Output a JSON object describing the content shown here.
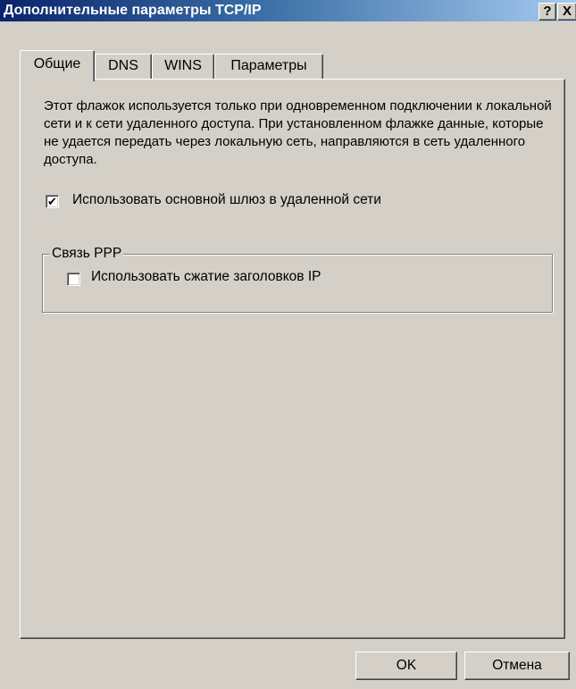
{
  "window": {
    "title": "Дополнительные параметры TCP/IP",
    "help_glyph": "?",
    "close_glyph": "X"
  },
  "tabs": [
    {
      "label": "Общие",
      "active": true
    },
    {
      "label": "DNS",
      "active": false
    },
    {
      "label": "WINS",
      "active": false
    },
    {
      "label": "Параметры",
      "active": false
    }
  ],
  "general": {
    "description": "Этот флажок используется только при одновременном подключении к локальной сети и к сети удаленного доступа. При установленном флажке данные, которые не удается передать через локальную сеть, направляются в сеть удаленного доступа.",
    "use_default_gateway": {
      "label": "Использовать основной шлюз в удаленной сети",
      "checked": true,
      "check_glyph": "✔"
    },
    "ppp_group": {
      "legend": "Связь PPP",
      "header_compression": {
        "label": "Использовать сжатие заголовков IP",
        "checked": false
      }
    }
  },
  "buttons": {
    "ok": "OK",
    "cancel": "Отмена"
  },
  "colors": {
    "title_bar_start": "#0a246a",
    "title_bar_end": "#a6caf0",
    "face": "#d4d0c8"
  }
}
